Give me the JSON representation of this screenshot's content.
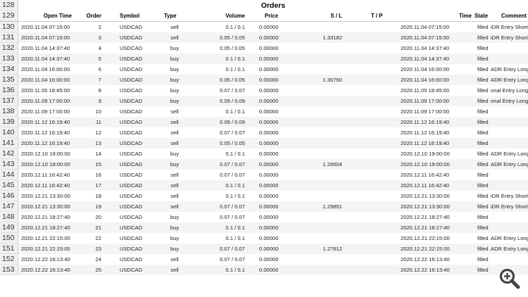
{
  "sheet": {
    "title_row_number": "128",
    "title": "Orders",
    "header_row_number": "129",
    "columns": {
      "open_time": "Open Time",
      "order": "Order",
      "symbol": "Symbol",
      "type": "Type",
      "volume": "Volume",
      "price": "Price",
      "sl": "S / L",
      "tp": "T / P",
      "time": "Time",
      "state": "State",
      "comment": "Comment"
    },
    "rows": [
      {
        "n": "130",
        "open_time": "2020.11.04 07:15:00",
        "order": "2",
        "symbol": "USDCAD",
        "type": "sell",
        "volume": "0.1 / 0.1",
        "price": "0.00000",
        "sl": "",
        "tp": "",
        "time": "2020.11.04 07:15:00",
        "state": "filled",
        "comment": "iDR Entry Short"
      },
      {
        "n": "131",
        "open_time": "2020.11.04 07:15:00",
        "order": "3",
        "symbol": "USDCAD",
        "type": "sell",
        "volume": "0.05 / 0.05",
        "price": "0.00000",
        "sl": "1.33182",
        "tp": "",
        "time": "2020.11.04 07:15:00",
        "state": "filled",
        "comment": "iDR Entry Short"
      },
      {
        "n": "132",
        "open_time": "2020.11.04 14:37:40",
        "order": "4",
        "symbol": "USDCAD",
        "type": "buy",
        "volume": "0.05 / 0.05",
        "price": "0.00000",
        "sl": "",
        "tp": "",
        "time": "2020.11.04 14:37:40",
        "state": "filled",
        "comment": ""
      },
      {
        "n": "133",
        "open_time": "2020.11.04 14:37:40",
        "order": "5",
        "symbol": "USDCAD",
        "type": "buy",
        "volume": "0.1 / 0.1",
        "price": "0.00000",
        "sl": "",
        "tp": "",
        "time": "2020.11.04 14:37:40",
        "state": "filled",
        "comment": ""
      },
      {
        "n": "134",
        "open_time": "2020.11.04 16:00:00",
        "order": "6",
        "symbol": "USDCAD",
        "type": "buy",
        "volume": "0.1 / 0.1",
        "price": "0.00000",
        "sl": "",
        "tp": "",
        "time": "2020.11.04 16:00:00",
        "state": "filled",
        "comment": "ADR Entry Long"
      },
      {
        "n": "135",
        "open_time": "2020.11.04 16:00:00",
        "order": "7",
        "symbol": "USDCAD",
        "type": "buy",
        "volume": "0.05 / 0.05",
        "price": "0.00000",
        "sl": "1.30760",
        "tp": "",
        "time": "2020.11.04 16:00:00",
        "state": "filled",
        "comment": "ADR Entry Long"
      },
      {
        "n": "136",
        "open_time": "2020.11.05 18:45:00",
        "order": "8",
        "symbol": "USDCAD",
        "type": "buy",
        "volume": "0.07 / 0.07",
        "price": "0.00000",
        "sl": "",
        "tp": "",
        "time": "2020.11.05 18:45:00",
        "state": "filled",
        "comment": "onal Entry Long"
      },
      {
        "n": "137",
        "open_time": "2020.11.09 17:00:00",
        "order": "9",
        "symbol": "USDCAD",
        "type": "buy",
        "volume": "0.09 / 0.09",
        "price": "0.00000",
        "sl": "",
        "tp": "",
        "time": "2020.11.09 17:00:00",
        "state": "filled",
        "comment": "onal Entry Long"
      },
      {
        "n": "138",
        "open_time": "2020.11.09 17:00:00",
        "order": "10",
        "symbol": "USDCAD",
        "type": "sell",
        "volume": "0.1 / 0.1",
        "price": "0.00000",
        "sl": "",
        "tp": "",
        "time": "2020.11.09 17:00:00",
        "state": "filled",
        "comment": ""
      },
      {
        "n": "139",
        "open_time": "2020.11.12 16:19:40",
        "order": "11",
        "symbol": "USDCAD",
        "type": "sell",
        "volume": "0.09 / 0.09",
        "price": "0.00000",
        "sl": "",
        "tp": "",
        "time": "2020.11.12 16:19:40",
        "state": "filled",
        "comment": ""
      },
      {
        "n": "140",
        "open_time": "2020.11.12 16:19:40",
        "order": "12",
        "symbol": "USDCAD",
        "type": "sell",
        "volume": "0.07 / 0.07",
        "price": "0.00000",
        "sl": "",
        "tp": "",
        "time": "2020.11.12 16:19:40",
        "state": "filled",
        "comment": ""
      },
      {
        "n": "141",
        "open_time": "2020.11.12 16:19:40",
        "order": "13",
        "symbol": "USDCAD",
        "type": "sell",
        "volume": "0.05 / 0.05",
        "price": "0.00000",
        "sl": "",
        "tp": "",
        "time": "2020.11.12 16:19:40",
        "state": "filled",
        "comment": ""
      },
      {
        "n": "142",
        "open_time": "2020.12.10 19:00:00",
        "order": "14",
        "symbol": "USDCAD",
        "type": "buy",
        "volume": "0.1 / 0.1",
        "price": "0.00000",
        "sl": "",
        "tp": "",
        "time": "2020.12.10 19:00:00",
        "state": "filled",
        "comment": "ADR Entry Long"
      },
      {
        "n": "143",
        "open_time": "2020.12.10 19:00:00",
        "order": "15",
        "symbol": "USDCAD",
        "type": "buy",
        "volume": "0.07 / 0.07",
        "price": "0.00000",
        "sl": "1.26604",
        "tp": "",
        "time": "2020.12.10 19:00:00",
        "state": "filled",
        "comment": "ADR Entry Long"
      },
      {
        "n": "144",
        "open_time": "2020.12.11 16:42:40",
        "order": "16",
        "symbol": "USDCAD",
        "type": "sell",
        "volume": "0.07 / 0.07",
        "price": "0.00000",
        "sl": "",
        "tp": "",
        "time": "2020.12.11 16:42:40",
        "state": "filled",
        "comment": ""
      },
      {
        "n": "145",
        "open_time": "2020.12.11 16:42:40",
        "order": "17",
        "symbol": "USDCAD",
        "type": "sell",
        "volume": "0.1 / 0.1",
        "price": "0.00000",
        "sl": "",
        "tp": "",
        "time": "2020.12.11 16:42:40",
        "state": "filled",
        "comment": ""
      },
      {
        "n": "146",
        "open_time": "2020.12.21 13:30:00",
        "order": "18",
        "symbol": "USDCAD",
        "type": "sell",
        "volume": "0.1 / 0.1",
        "price": "0.00000",
        "sl": "",
        "tp": "",
        "time": "2020.12.21 13:30:00",
        "state": "filled",
        "comment": "iDR Entry Short"
      },
      {
        "n": "147",
        "open_time": "2020.12.21 13:30:00",
        "order": "19",
        "symbol": "USDCAD",
        "type": "sell",
        "volume": "0.07 / 0.07",
        "price": "0.00000",
        "sl": "1.29851",
        "tp": "",
        "time": "2020.12.21 13:30:00",
        "state": "filled",
        "comment": "iDR Entry Short"
      },
      {
        "n": "148",
        "open_time": "2020.12.21 18:27:40",
        "order": "20",
        "symbol": "USDCAD",
        "type": "buy",
        "volume": "0.07 / 0.07",
        "price": "0.00000",
        "sl": "",
        "tp": "",
        "time": "2020.12.21 18:27:40",
        "state": "filled",
        "comment": ""
      },
      {
        "n": "149",
        "open_time": "2020.12.21 18:27:40",
        "order": "21",
        "symbol": "USDCAD",
        "type": "buy",
        "volume": "0.1 / 0.1",
        "price": "0.00000",
        "sl": "",
        "tp": "",
        "time": "2020.12.21 18:27:40",
        "state": "filled",
        "comment": ""
      },
      {
        "n": "150",
        "open_time": "2020.12.21 22:15:00",
        "order": "22",
        "symbol": "USDCAD",
        "type": "buy",
        "volume": "0.1 / 0.1",
        "price": "0.00000",
        "sl": "",
        "tp": "",
        "time": "2020.12.21 22:15:00",
        "state": "filled",
        "comment": "ADR Entry Long"
      },
      {
        "n": "151",
        "open_time": "2020.12.21 22:15:00",
        "order": "23",
        "symbol": "USDCAD",
        "type": "buy",
        "volume": "0.07 / 0.07",
        "price": "0.00000",
        "sl": "1.27612",
        "tp": "",
        "time": "2020.12.21 22:15:00",
        "state": "filled",
        "comment": "ADR Entry Long"
      },
      {
        "n": "152",
        "open_time": "2020.12.22 16:13:40",
        "order": "24",
        "symbol": "USDCAD",
        "type": "sell",
        "volume": "0.07 / 0.07",
        "price": "0.00000",
        "sl": "",
        "tp": "",
        "time": "2020.12.22 16:13:40",
        "state": "filled",
        "comment": ""
      },
      {
        "n": "153",
        "open_time": "2020.12.22 16:13:40",
        "order": "25",
        "symbol": "USDCAD",
        "type": "sell",
        "volume": "0.1 / 0.1",
        "price": "0.00000",
        "sl": "",
        "tp": "",
        "time": "2020.12.22 16:13:40",
        "state": "filled",
        "comment": ""
      }
    ]
  },
  "zoom_button": {
    "icon": "zoom-in-icon",
    "color": "#444444"
  }
}
